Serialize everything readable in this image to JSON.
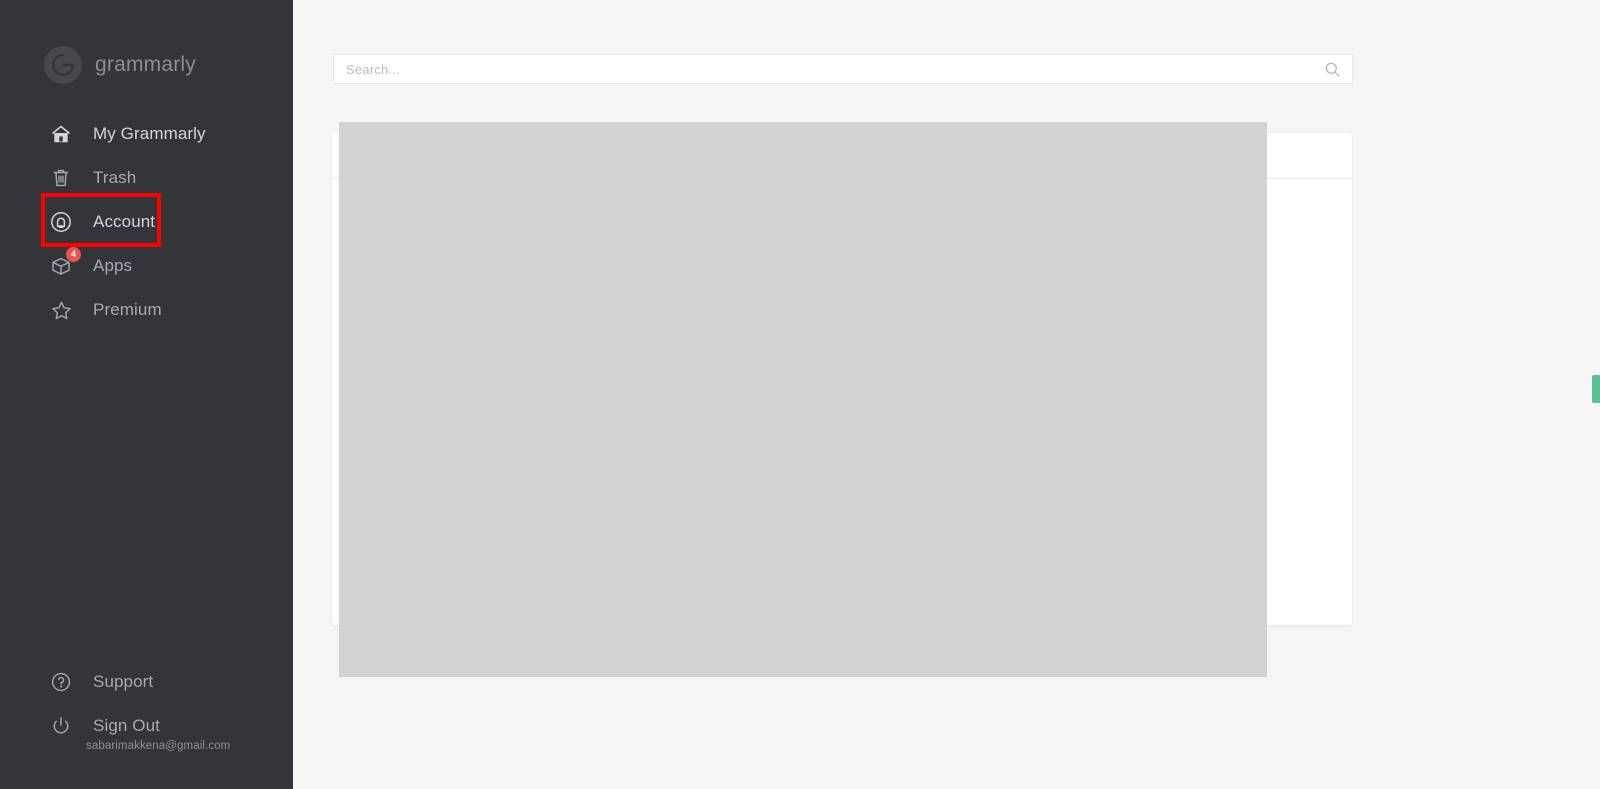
{
  "app": {
    "brand_name": "grammarly",
    "brand_logo_icon": "grammarly-g-logo-icon"
  },
  "sidebar": {
    "background_color": "#333539",
    "items": [
      {
        "label": "My Grammarly",
        "icon": "home-icon",
        "name": "my-grammarly"
      },
      {
        "label": "Trash",
        "icon": "trash-icon",
        "name": "trash"
      },
      {
        "label": "Account",
        "icon": "account-circle-icon",
        "name": "account",
        "highlighted": true
      },
      {
        "label": "Apps",
        "icon": "cube-box-icon",
        "name": "apps",
        "badge": "4"
      },
      {
        "label": "Premium",
        "icon": "star-icon",
        "name": "premium"
      }
    ],
    "bottom_items": [
      {
        "label": "Support",
        "icon": "question-circle-icon",
        "name": "support"
      },
      {
        "label": "Sign Out",
        "icon": "power-icon",
        "name": "sign-out"
      }
    ],
    "account_email": "sabarimakkena@gmail.com"
  },
  "annotation": {
    "color": "#fe0000",
    "target": "Account"
  },
  "search": {
    "placeholder": "Search...",
    "value": "",
    "icon": "search-magnifier-icon"
  },
  "main": {
    "document_card_name": "document-list-card",
    "content_placeholder_color": "#d2d2d3"
  },
  "feedback_tab": {
    "color": "#5cc295",
    "name": "feedback-tab"
  }
}
